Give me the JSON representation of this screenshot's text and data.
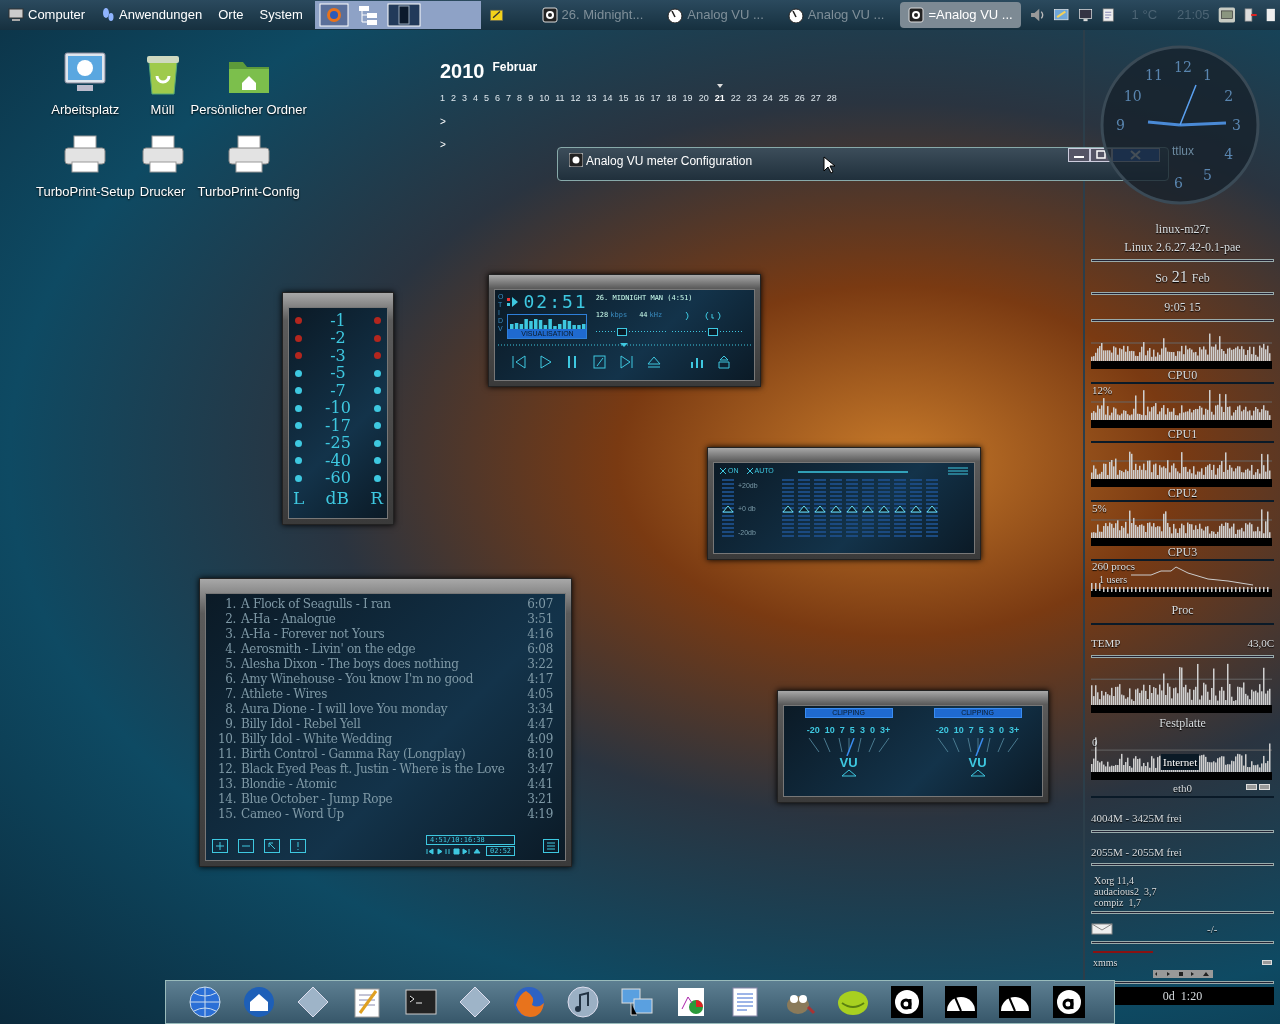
{
  "top_panel": {
    "menus": [
      "Computer",
      "Anwendungen",
      "Orte",
      "System"
    ],
    "tasks": [
      {
        "label": "26. Midnight...",
        "kind": "player",
        "selected": false
      },
      {
        "label": "Analog VU ...",
        "kind": "meter",
        "selected": false
      },
      {
        "label": "Analog VU ...",
        "kind": "meter",
        "selected": false
      },
      {
        "label": "=Analog VU ...",
        "kind": "player",
        "selected": true
      }
    ],
    "weather": "1 °C",
    "clock": "21:05"
  },
  "desktop_icons": [
    {
      "label": "Arbeitsplatz",
      "kind": "monitor"
    },
    {
      "label": "Müll",
      "kind": "trash"
    },
    {
      "label": "Persönlicher Ordner",
      "kind": "folder"
    },
    {
      "label": "TurboPrint-Setup",
      "kind": "printer"
    },
    {
      "label": "Drucker",
      "kind": "printer"
    },
    {
      "label": "TurboPrint-Config",
      "kind": "printer"
    }
  ],
  "calendar": {
    "year": "2010",
    "month": "Februar",
    "days": [
      {
        "label": "1",
        "selected": false
      },
      {
        "label": "2",
        "selected": false
      },
      {
        "label": "3",
        "selected": false
      },
      {
        "label": "4",
        "selected": false
      },
      {
        "label": "5",
        "selected": false
      },
      {
        "label": "6",
        "selected": false
      },
      {
        "label": "7",
        "selected": false
      },
      {
        "label": "8",
        "selected": false
      },
      {
        "label": "9",
        "selected": false
      },
      {
        "label": "10",
        "selected": false
      },
      {
        "label": "11",
        "selected": false
      },
      {
        "label": "12",
        "selected": false
      },
      {
        "label": "13",
        "selected": false
      },
      {
        "label": "14",
        "selected": false
      },
      {
        "label": "15",
        "selected": false
      },
      {
        "label": "16",
        "selected": false
      },
      {
        "label": "17",
        "selected": false
      },
      {
        "label": "18",
        "selected": false
      },
      {
        "label": "19",
        "selected": false
      },
      {
        "label": "20",
        "selected": false
      },
      {
        "label": "21",
        "selected": true
      },
      {
        "label": "22",
        "selected": false
      },
      {
        "label": "23",
        "selected": false
      },
      {
        "label": "24",
        "selected": false
      },
      {
        "label": "25",
        "selected": false
      },
      {
        "label": "26",
        "selected": false
      },
      {
        "label": "27",
        "selected": false
      },
      {
        "label": "28",
        "selected": false
      }
    ],
    "expanders": [
      ">",
      ">"
    ]
  },
  "config_window": {
    "title": "Analog VU meter Configuration"
  },
  "clock_widget": {
    "numerals": [
      "12",
      "1",
      "2",
      "3",
      "4",
      "5",
      "6",
      "9",
      "10",
      "11"
    ],
    "label": "ttlux"
  },
  "vu_meter": {
    "rows": [
      {
        "label": "-1",
        "color": "#b3261e"
      },
      {
        "label": "-2",
        "color": "#b3261e"
      },
      {
        "label": "-3",
        "color": "#b3261e"
      },
      {
        "label": "-5",
        "color": "#3ec8e0"
      },
      {
        "label": "-7",
        "color": "#3ec8e0"
      },
      {
        "label": "-10",
        "color": "#3ec8e0"
      },
      {
        "label": "-17",
        "color": "#3ec8e0"
      },
      {
        "label": "-25",
        "color": "#3ec8e0"
      },
      {
        "label": "-40",
        "color": "#3ec8e0"
      },
      {
        "label": "-60",
        "color": "#3ec8e0"
      }
    ],
    "footer": [
      "L",
      "dB",
      "R"
    ]
  },
  "player": {
    "side_letters": [
      "O",
      "T",
      "I",
      "D",
      "V"
    ],
    "time": "02:51",
    "title": "26. MIDNIGHT MAN (4:51)",
    "bitrate": "128",
    "bitrate_unit": "kbps",
    "samplerate": "44",
    "samplerate_unit": "kHz",
    "visualisation": "VISUALISATION",
    "volume": {
      "level": 0.35
    },
    "balance": {
      "level": 0.6
    }
  },
  "equalizer": {
    "toggles": [
      "ON",
      "AUTO"
    ],
    "scale": [
      "+20db",
      "+0 db",
      "-20db"
    ],
    "preamp": {
      "level": 0.5
    },
    "bands": [
      {
        "level": 0.5
      },
      {
        "level": 0.5
      },
      {
        "level": 0.5
      },
      {
        "level": 0.5
      },
      {
        "level": 0.5
      },
      {
        "level": 0.5
      },
      {
        "level": 0.5
      },
      {
        "level": 0.5
      },
      {
        "level": 0.5
      },
      {
        "level": 0.5
      }
    ]
  },
  "analog_vu": {
    "meters": [
      {
        "clipping": "CLIPPING",
        "scale": [
          "-20",
          "10",
          "7",
          "5",
          "3",
          "0",
          "3+"
        ],
        "label": "VU"
      },
      {
        "clipping": "CLIPPING",
        "scale": [
          "-20",
          "10",
          "7",
          "5",
          "3",
          "0",
          "3+"
        ],
        "label": "VU"
      }
    ]
  },
  "playlist": {
    "tracks": [
      {
        "number": "1.",
        "title": "A Flock of Seagulls - I ran",
        "time": "6:07"
      },
      {
        "number": "2.",
        "title": "A-Ha - Analogue",
        "time": "3:51"
      },
      {
        "number": "3.",
        "title": "A-Ha - Forever not Yours",
        "time": "4:16"
      },
      {
        "number": "4.",
        "title": "Aerosmith - Livin' on the edge",
        "time": "6:08"
      },
      {
        "number": "5.",
        "title": "Alesha Dixon - The boys does nothing",
        "time": "3:22"
      },
      {
        "number": "6.",
        "title": "Amy Winehouse - You know I'm no good",
        "time": "4:17"
      },
      {
        "number": "7.",
        "title": "Athlete - Wires",
        "time": "4:05"
      },
      {
        "number": "8.",
        "title": "Aura Dione - I will love You monday",
        "time": "3:34"
      },
      {
        "number": "9.",
        "title": "Billy Idol - Rebel Yell",
        "time": "4:47"
      },
      {
        "number": "10.",
        "title": "Billy Idol - White Wedding",
        "time": "4:09"
      },
      {
        "number": "11.",
        "title": "Birth Control - Gamma Ray (Longplay)",
        "time": "8:10"
      },
      {
        "number": "12.",
        "title": "Black Eyed Peas ft. Justin - Where is the Love",
        "time": "3:47"
      },
      {
        "number": "13.",
        "title": "Blondie - Atomic",
        "time": "4:41"
      },
      {
        "number": "14.",
        "title": "Blue October - Jump Rope",
        "time": "3:21"
      },
      {
        "number": "15.",
        "title": "Cameo - Word Up",
        "time": "4:19"
      }
    ],
    "position": "4:51/10:16:38",
    "elapsed": "02:52"
  },
  "conky": {
    "host": "linux-m27r",
    "kernel": "Linux 2.6.27.42-0.1-pae",
    "weekday": "So",
    "day": "21",
    "month": "Feb",
    "time": "9:05 15",
    "cpus": [
      {
        "label": "CPU0"
      },
      {
        "label": "CPU1",
        "load": "12%"
      },
      {
        "label": "CPU2"
      },
      {
        "label": "CPU3",
        "load": "5%"
      }
    ],
    "procs": "260 procs",
    "users": "1 users",
    "proc_label": "Proc",
    "temp_label": "TEMP",
    "temp": "43,0C",
    "disk_label": "Festplatte",
    "net_zero": "0",
    "net_label": "Internet",
    "net_iface": "eth0",
    "memory": [
      "4004M - 3425M frei",
      "2055M - 2055M frei"
    ],
    "top_procs": [
      "Xorg 11,4",
      "audacious2  3,7",
      "compiz  1,7"
    ],
    "mail": "-/-",
    "media_player": "xmms",
    "uptime": "0d  1:20"
  },
  "dock": {
    "icons": [
      {
        "kind": "globe"
      },
      {
        "kind": "home"
      },
      {
        "kind": "diamond"
      },
      {
        "kind": "notepad"
      },
      {
        "kind": "terminal"
      },
      {
        "kind": "diamond"
      },
      {
        "kind": "firefox"
      },
      {
        "kind": "music"
      },
      {
        "kind": "network"
      },
      {
        "kind": "chart"
      },
      {
        "kind": "document"
      },
      {
        "kind": "gimp"
      },
      {
        "kind": "melon"
      },
      {
        "kind": "letter"
      },
      {
        "kind": "gauge"
      },
      {
        "kind": "gauge"
      },
      {
        "kind": "letter"
      }
    ]
  }
}
